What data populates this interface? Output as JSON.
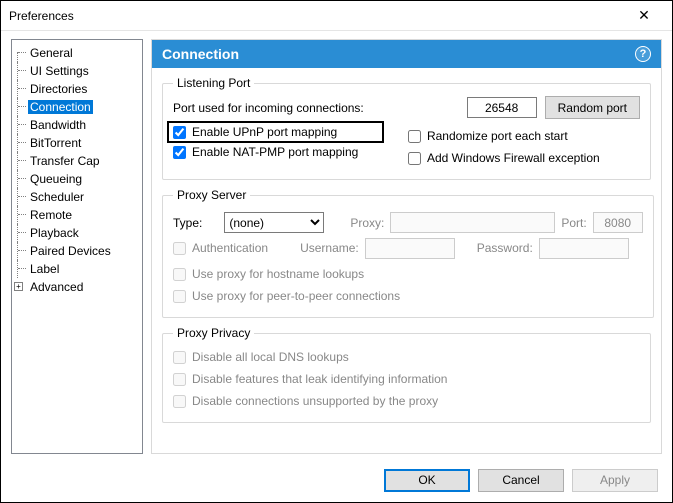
{
  "window": {
    "title": "Preferences"
  },
  "tree": {
    "items": [
      "General",
      "UI Settings",
      "Directories",
      "Connection",
      "Bandwidth",
      "BitTorrent",
      "Transfer Cap",
      "Queueing",
      "Scheduler",
      "Remote",
      "Playback",
      "Paired Devices",
      "Label",
      "Advanced"
    ],
    "selected_index": 3,
    "expandable_index": 13
  },
  "panel": {
    "title": "Connection"
  },
  "listening": {
    "legend": "Listening Port",
    "port_label": "Port used for incoming connections:",
    "port_value": "26548",
    "random_btn": "Random port",
    "upnp": {
      "label": "Enable UPnP port mapping",
      "checked": true
    },
    "natpmp": {
      "label": "Enable NAT-PMP port mapping",
      "checked": true
    },
    "randomize": {
      "label": "Randomize port each start",
      "checked": false
    },
    "firewall": {
      "label": "Add Windows Firewall exception",
      "checked": false
    }
  },
  "proxy": {
    "legend": "Proxy Server",
    "type_label": "Type:",
    "type_value": "(none)",
    "proxy_label": "Proxy:",
    "port_label": "Port:",
    "port_value": "8080",
    "auth": "Authentication",
    "user_label": "Username:",
    "pass_label": "Password:",
    "hostname": "Use proxy for hostname lookups",
    "p2p": "Use proxy for peer-to-peer connections"
  },
  "privacy": {
    "legend": "Proxy Privacy",
    "dns": "Disable all local DNS lookups",
    "leak": "Disable features that leak identifying information",
    "unsupported": "Disable connections unsupported by the proxy"
  },
  "footer": {
    "ok": "OK",
    "cancel": "Cancel",
    "apply": "Apply"
  }
}
